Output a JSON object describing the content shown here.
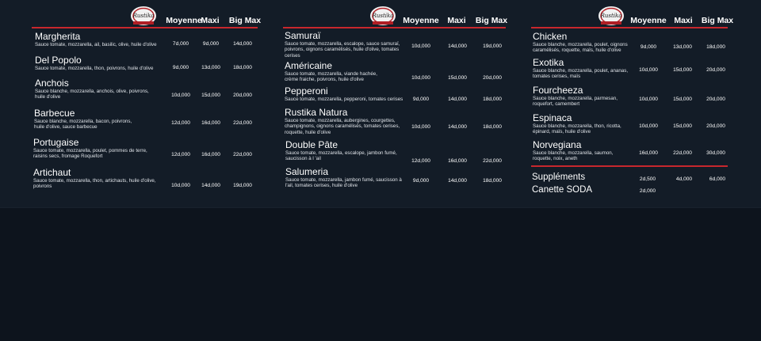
{
  "colors": {
    "accent": "#c8272d",
    "background": "#131c27"
  },
  "logo": {
    "text": "Rustika"
  },
  "headers": [
    "Moyenne",
    "Maxi",
    "Big Max"
  ],
  "col1": [
    {
      "name": "Margherita",
      "desc": "Sauce tomate, mozzarella, ail, basilic, olive, huile d'olive",
      "p1": "7d,000",
      "p2": "9d,000",
      "p3": "14d,000"
    },
    {
      "name": "Del Popolo",
      "desc": "Sauce tomate, mozzarella, thon, poivrons, huile d'olive",
      "p1": "9d,000",
      "p2": "13d,000",
      "p3": "18d,000"
    },
    {
      "name": "Anchois",
      "desc": "Sauce blanche, mozzarella,  anchois, olive, poivrons, huile d'olive",
      "p1": "10d,000",
      "p2": "15d,000",
      "p3": "20d,000"
    },
    {
      "name": "Barbecue",
      "desc": "Sauce blanche, mozzarella, bacon, poivrons, huile d'olive, sauce barbecue",
      "p1": "12d,000",
      "p2": "16d,000",
      "p3": "22d,000"
    },
    {
      "name": "Portugaise",
      "desc": "Sauce tomate, mozzarella, poulet, pommes de terre, raisins secs, fromage Roquefort",
      "p1": "12d,000",
      "p2": "16d,000",
      "p3": "22d,000"
    },
    {
      "name": "Artichaut",
      "desc": "Sauce tomate, mozzarella, thon, artichauts, huile d'olive, poivrons",
      "p1": "10d,000",
      "p2": "14d,000",
      "p3": "19d,000"
    }
  ],
  "col2": [
    {
      "name": "Samuraï",
      "desc": "Sauce tomate, mozzarella, escalope, sauce samuraï, poivrons, oignons caramélisés, huile d'olive, tomates cerises",
      "p1": "10d,000",
      "p2": "14d,000",
      "p3": "19d,000"
    },
    {
      "name": "Américaine",
      "desc": "Sauce tomate, mozzarella, viande hachée, crème fraiche, poivrons, huile d'olive",
      "p1": "10d,000",
      "p2": "15d,000",
      "p3": "20d,000"
    },
    {
      "name": "Pepperoni",
      "desc": "Sauce tomate, mozzarella, pepperoni, tomates cerises",
      "p1": "9d,000",
      "p2": "14d,000",
      "p3": "18d,000"
    },
    {
      "name": "Rustika Natura",
      "desc": "Sauce tomate, mozzarella, aubergines, courgettes, champignons, oignons caramélisés, tomates cerises, roquette, huile d'olive",
      "p1": "10d,000",
      "p2": "14d,000",
      "p3": "18d,000"
    },
    {
      "name": "Double Pâte",
      "desc": "Sauce tomate, mozzarella, escalope, jambon fumé, saucisson à l 'ail",
      "p1": "12d,000",
      "p2": "16d,000",
      "p3": "22d,000"
    },
    {
      "name": "Salumeria",
      "desc": "Sauce tomate, mozzarella, jambon fumé, saucisson à l'ail, tomates cerises, huile d'olive",
      "p1": "9d,000",
      "p2": "14d,000",
      "p3": "18d,000"
    }
  ],
  "col3": [
    {
      "name": "Chicken",
      "desc": "Sauce blanche, mozzarella,  poulet, oignons caramélisés, roquette, maïs, huile d'olive",
      "p1": "9d,000",
      "p2": "13d,000",
      "p3": "18d,000"
    },
    {
      "name": "Exotika",
      "desc": "Sauce blanche, mozzarella, poulet, ananas, tomates cerises, maïs",
      "p1": "10d,000",
      "p2": "15d,000",
      "p3": "20d,000"
    },
    {
      "name": "Fourcheeza",
      "desc": "Sauce blanche, mozzarella,  parmesan, roquefort, camembert",
      "p1": "10d,000",
      "p2": "15d,000",
      "p3": "20d,000"
    },
    {
      "name": "Espinaca",
      "desc": "Sauce blanche, mozzarella, thon, ricotta, épinard, maïs, huile d'olive",
      "p1": "10d,000",
      "p2": "15d,000",
      "p3": "20d,000"
    },
    {
      "name": "Norvegiana",
      "desc": "Sauce blanche, mozzarella, saumon, roquette, noix, aneth",
      "p1": "16d,000",
      "p2": "22d,000",
      "p3": "30d,000"
    }
  ],
  "extras": {
    "supplements": {
      "name": "Suppléments",
      "p1": "2d,500",
      "p2": "4d,000",
      "p3": "6d,000"
    },
    "canette": {
      "name": "Canette SODA",
      "p1": "2d,000"
    }
  }
}
